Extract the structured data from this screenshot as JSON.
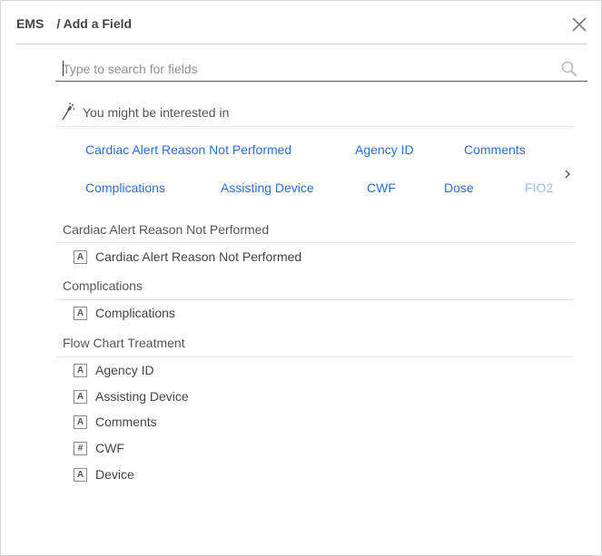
{
  "header": {
    "app": "EMS",
    "title": "/ Add a Field"
  },
  "search": {
    "placeholder": "Type to search for fields"
  },
  "suggestions": {
    "label": "You might be interested in",
    "chips": [
      "Cardiac Alert Reason Not Performed",
      "Agency ID",
      "Comments",
      "Complications",
      "Assisting Device",
      "CWF",
      "Dose",
      "FIO2"
    ]
  },
  "groups": [
    {
      "title": "Cardiac Alert Reason Not Performed",
      "items": [
        {
          "label": "Cardiac Alert Reason Not Performed",
          "icon": "text-field-icon",
          "glyph": "A"
        }
      ]
    },
    {
      "title": "Complications",
      "items": [
        {
          "label": "Complications",
          "icon": "text-field-icon",
          "glyph": "A"
        }
      ]
    },
    {
      "title": "Flow Chart Treatment",
      "items": [
        {
          "label": "Agency ID",
          "icon": "text-field-icon",
          "glyph": "A"
        },
        {
          "label": "Assisting Device",
          "icon": "text-field-icon",
          "glyph": "A"
        },
        {
          "label": "Comments",
          "icon": "text-field-icon",
          "glyph": "A"
        },
        {
          "label": "CWF",
          "icon": "number-field-icon",
          "glyph": "#"
        },
        {
          "label": "Device",
          "icon": "text-field-icon",
          "glyph": "A"
        }
      ]
    }
  ],
  "colors": {
    "link": "#2b6fd1",
    "text": "#444444",
    "divider": "#e3e3e3"
  }
}
